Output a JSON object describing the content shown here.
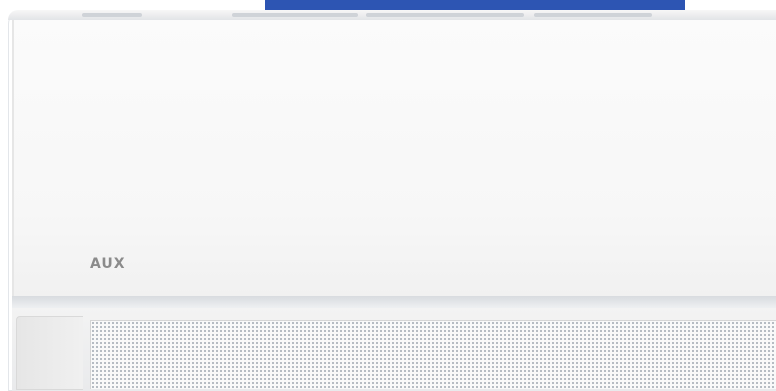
{
  "image": {
    "subject": "air-conditioner-indoor-unit",
    "brand_logo_text": "AUX",
    "colors": {
      "top_band": "#2d55b3",
      "unit_body": "#ffffff",
      "logo_text": "#8b8b8b",
      "grille_dots": "#9fa7b1"
    }
  }
}
